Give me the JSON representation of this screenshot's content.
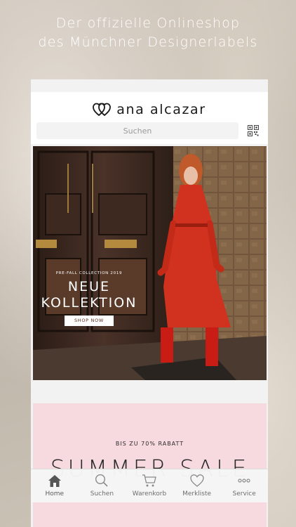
{
  "promo": {
    "line1": "Der offizielle Onlineshop",
    "line2": "des Münchner Designerlabels"
  },
  "app": {
    "logo_text": "ana alcazar",
    "search": {
      "placeholder": "Suchen"
    },
    "hero": {
      "subtitle": "PRE-FALL COLLECTION 2019",
      "title_line1": "NEUE",
      "title_line2": "KOLLEKTION",
      "cta": "SHOP NOW"
    },
    "sale": {
      "subtitle": "BIS ZU 70% RABATT",
      "title": "SUMMER SALE"
    },
    "tabs": [
      {
        "label": "Home",
        "icon": "home-icon",
        "active": true
      },
      {
        "label": "Suchen",
        "icon": "search-icon",
        "active": false
      },
      {
        "label": "Warenkorb",
        "icon": "cart-icon",
        "active": false
      },
      {
        "label": "Merkliste",
        "icon": "heart-icon",
        "active": false
      },
      {
        "label": "Service",
        "icon": "more-icon",
        "active": false
      }
    ]
  },
  "colors": {
    "sale_bg": "#f7dadf",
    "dress_red": "#d0321f",
    "tab_icon": "#8a8a8a",
    "tab_icon_active": "#555555"
  }
}
